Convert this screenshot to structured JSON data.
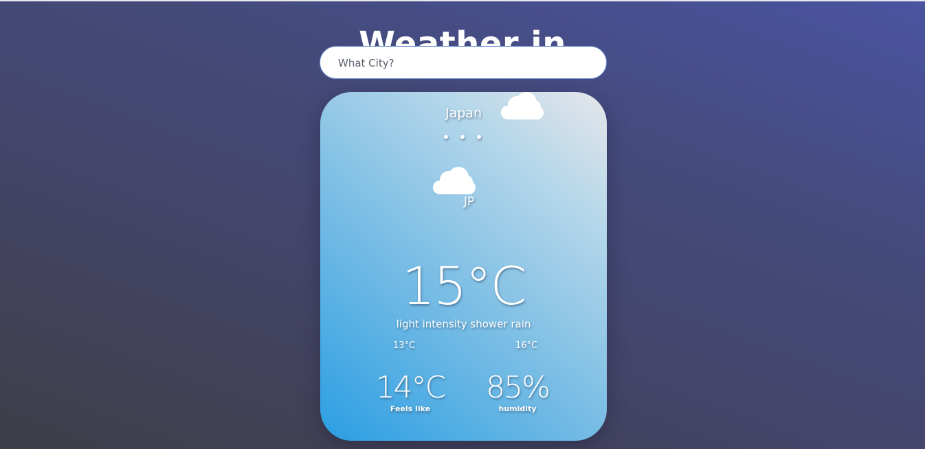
{
  "header": {
    "title": "Weather in"
  },
  "search": {
    "placeholder": "What City?",
    "value": ""
  },
  "weather": {
    "country_name": "Japan",
    "loading_dots": "• • •",
    "country_code": "JP",
    "temperature": "15°C",
    "description": "light intensity shower rain",
    "temp_min": "13°C",
    "temp_max": "16°C",
    "feels_like": "14°C",
    "feels_like_label": "Feels like",
    "humidity": "85%",
    "humidity_label": "humidity",
    "icons": [
      "cloud-icon",
      "cloud-icon"
    ]
  },
  "colors": {
    "background_top": "#4a54a0",
    "background_bottom": "#3e3e48",
    "card_light": "#e6e6ea",
    "card_blue": "#2a9ee3",
    "text": "#ffffff"
  }
}
